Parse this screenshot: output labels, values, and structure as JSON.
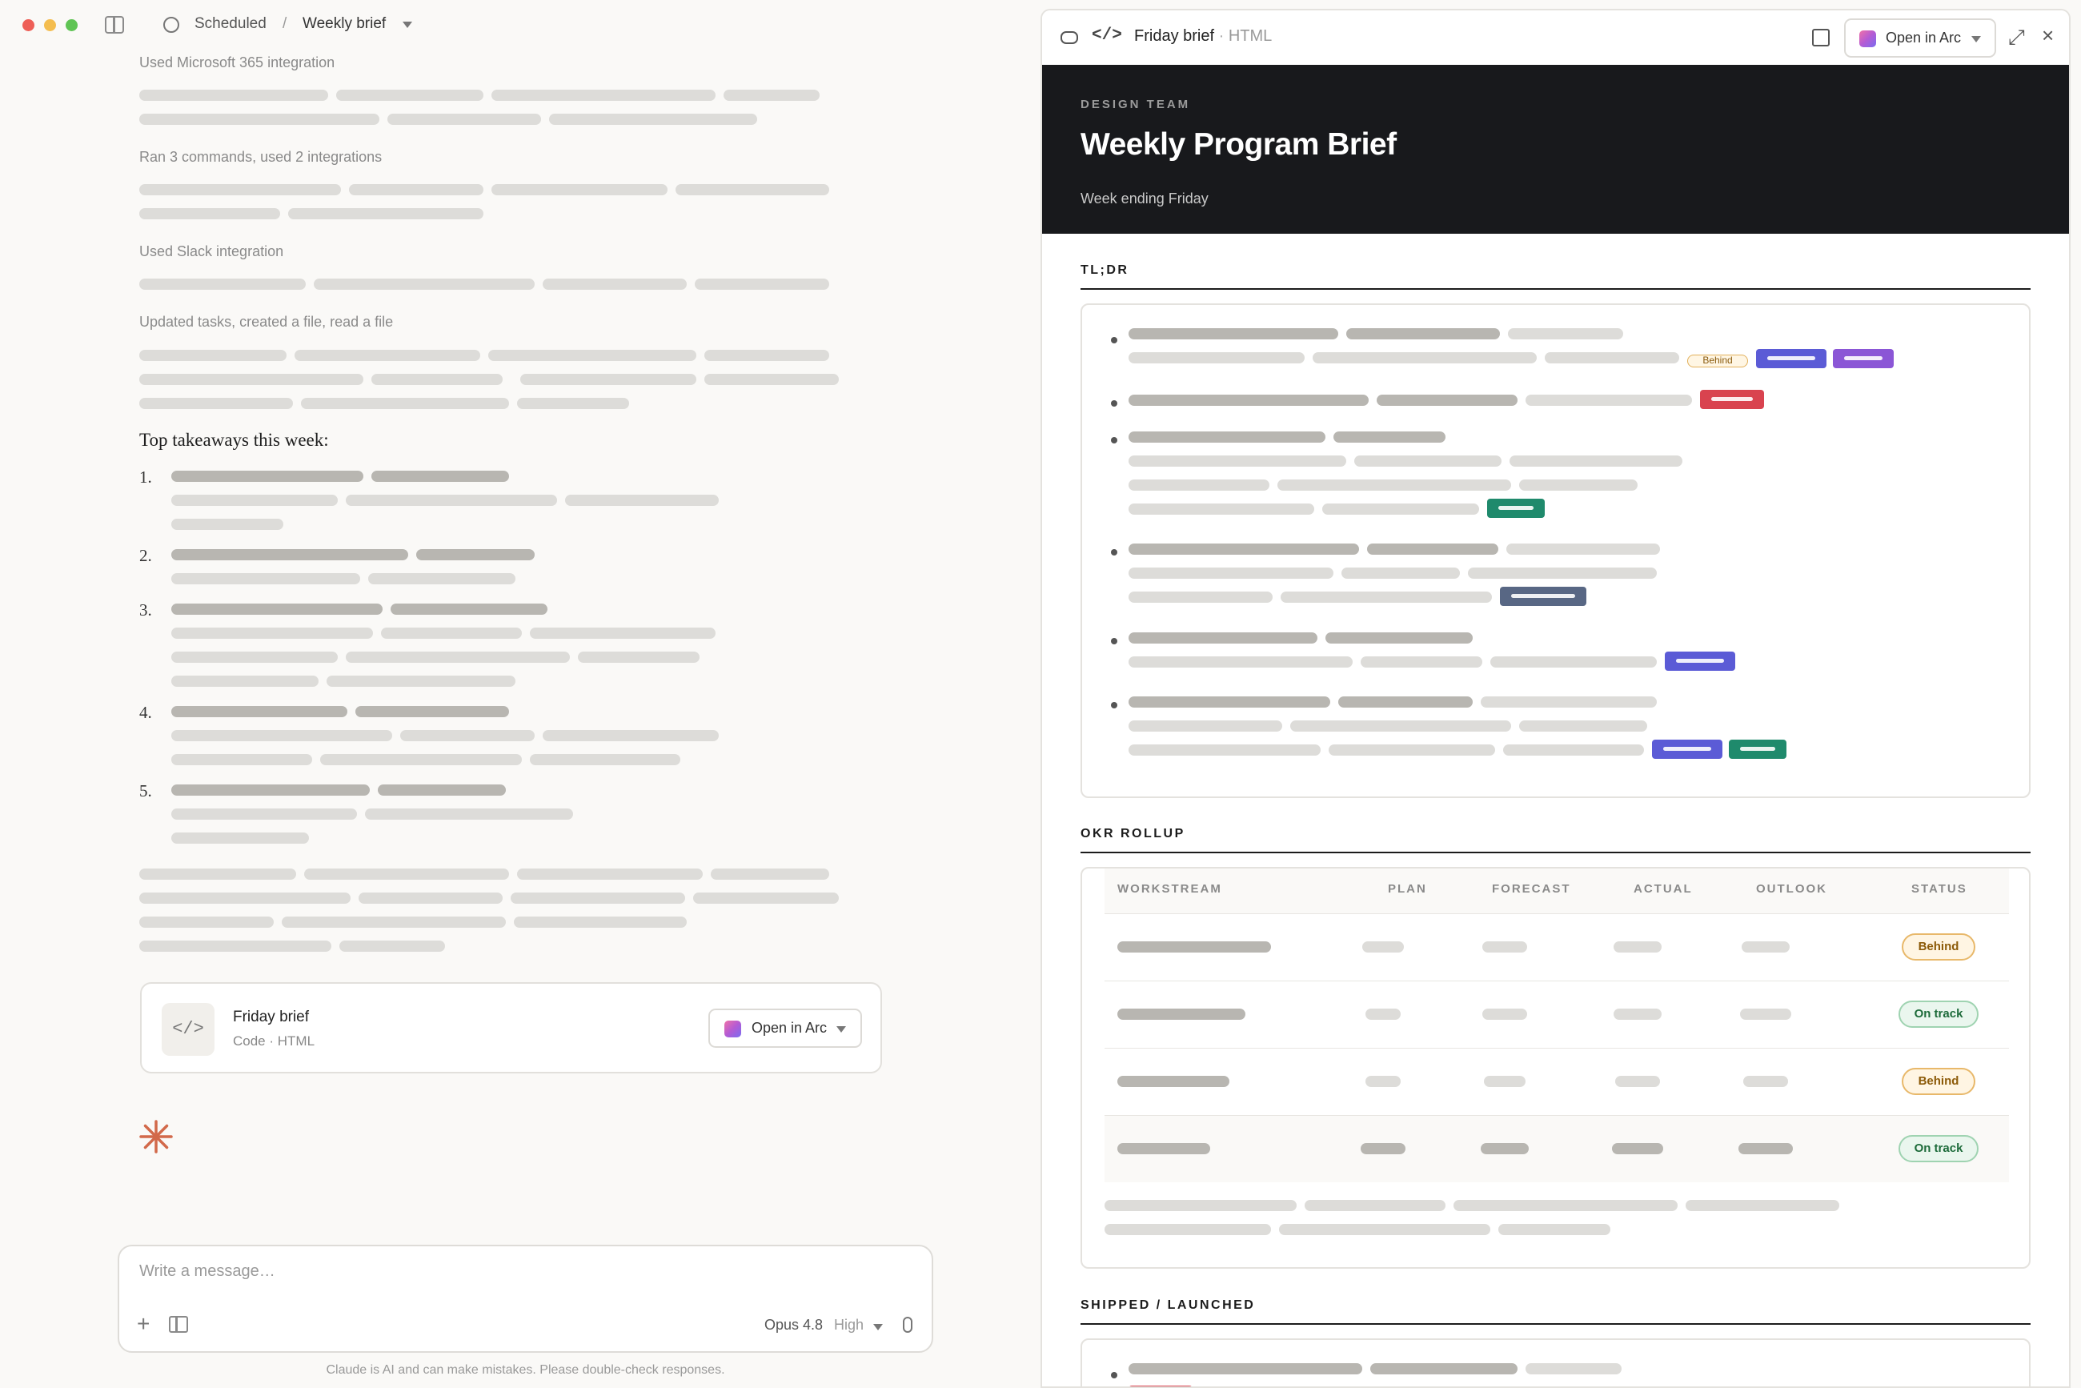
{
  "topbar": {
    "scheduled_label": "Scheduled",
    "separator": "/",
    "conversation_title": "Weekly brief"
  },
  "conversation": {
    "steps": [
      "Used Microsoft 365 integration",
      "Ran 3 commands, used 2 integrations",
      "Used Slack integration",
      "Updated tasks, created a file, read a file"
    ],
    "takeaways_heading": "Top takeaways this week:",
    "takeaway_numbers": [
      "1.",
      "2.",
      "3.",
      "4.",
      "5."
    ]
  },
  "artifact_card": {
    "icon": "</>",
    "title": "Friday brief",
    "subtitle": "Code · HTML",
    "open_label": "Open in Arc"
  },
  "composer": {
    "placeholder": "Write a message…",
    "plus": "+",
    "model": "Opus 4.8",
    "effort": "High"
  },
  "disclaimer": "Claude is AI and can make mistakes. Please double-check responses.",
  "preview": {
    "code_icon": "</>",
    "title": "Friday brief",
    "dot": "·",
    "subtitle": "HTML",
    "open_label": "Open in Arc",
    "expand_icon": "⤢",
    "close_icon": "×"
  },
  "document": {
    "eyebrow": "DESIGN TEAM",
    "title": "Weekly Program Brief",
    "subtitle": "Week ending Friday",
    "tldr_heading": "TL;DR",
    "behind_tag": "Behind",
    "okr_heading": "OKR ROLLUP",
    "okr_columns": [
      "WORKSTREAM",
      "PLAN",
      "FORECAST",
      "ACTUAL",
      "OUTLOOK",
      "STATUS"
    ],
    "okr_statuses": [
      "Behind",
      "On track",
      "Behind",
      "On track"
    ],
    "shipped_heading": "SHIPPED / LAUNCHED"
  },
  "colors": {
    "accent_indigo": "#5b5bd6",
    "accent_violet": "#8b56d6",
    "accent_red": "#d9434f",
    "accent_green": "#1f8a6c",
    "accent_slate": "#586784",
    "header_bg": "#18191c",
    "spark": "#d2694a"
  }
}
